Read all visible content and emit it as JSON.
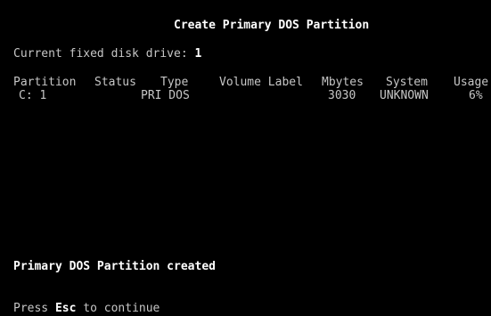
{
  "screen": {
    "title": "Create Primary DOS Partition",
    "current_drive_label": "Current fixed disk drive:",
    "current_drive_value": "1"
  },
  "table": {
    "headers": {
      "partition": "Partition",
      "status": "Status",
      "type": "Type",
      "volume_label": "Volume Label",
      "mbytes": "Mbytes",
      "system": "System",
      "usage": "Usage"
    },
    "rows": [
      {
        "partition": "C: 1",
        "status": "",
        "type": "PRI DOS",
        "volume_label": "",
        "mbytes": "3030",
        "system": "UNKNOWN",
        "usage": "6%"
      }
    ]
  },
  "message": "Primary DOS Partition created",
  "footer": {
    "prefix": "Press",
    "key": "Esc",
    "suffix": "to continue"
  },
  "colors": {
    "background": "#000000",
    "text": "#c6c6c6",
    "bright": "#ffffff"
  }
}
